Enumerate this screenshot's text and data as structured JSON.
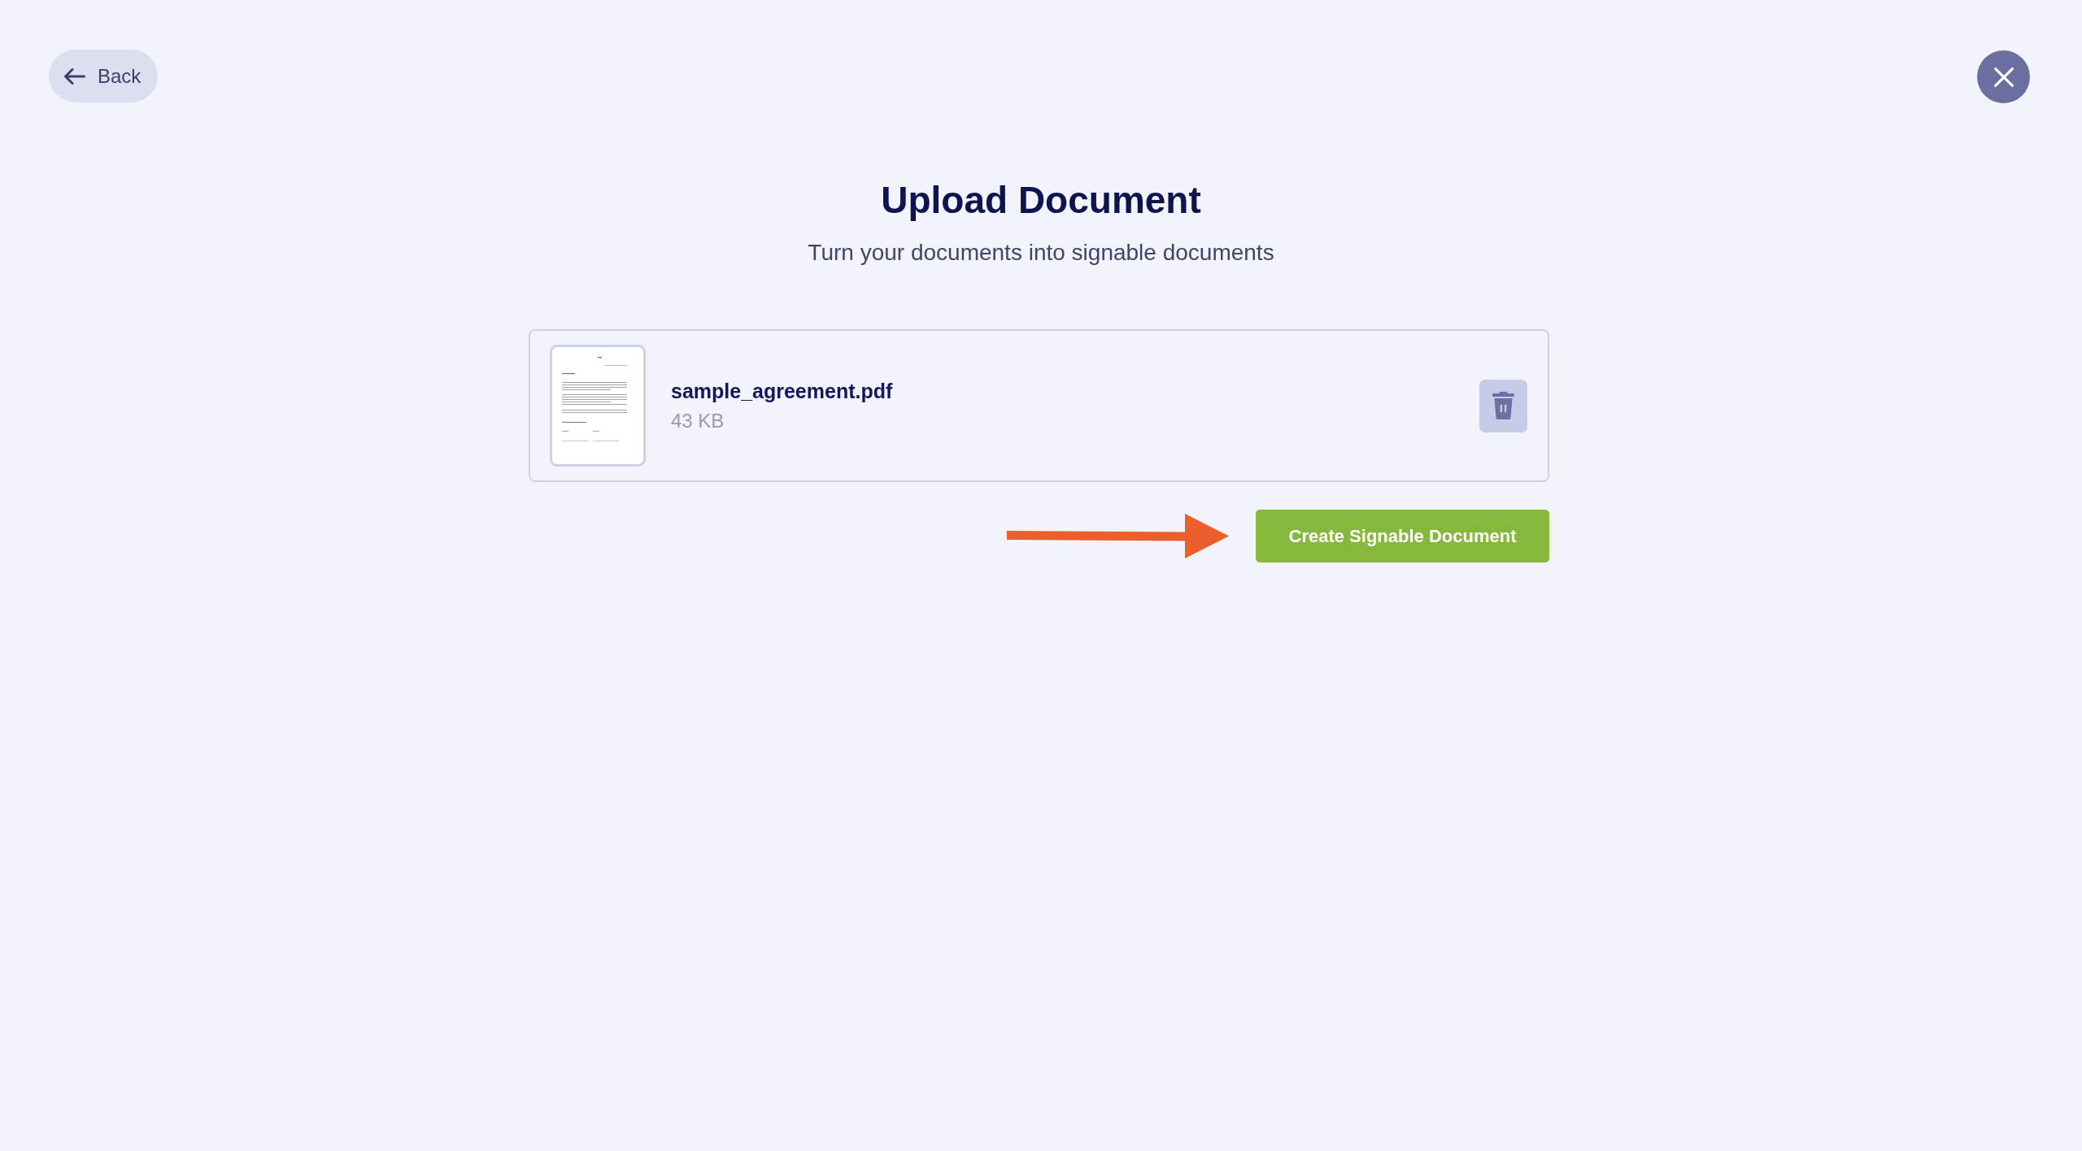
{
  "back_button": {
    "label": "Back"
  },
  "header": {
    "title": "Upload Document",
    "subtitle": "Turn your documents into signable documents"
  },
  "files": [
    {
      "name": "sample_agreement.pdf",
      "size": "43 KB"
    }
  ],
  "primary_button": {
    "label": "Create Signable Document"
  }
}
